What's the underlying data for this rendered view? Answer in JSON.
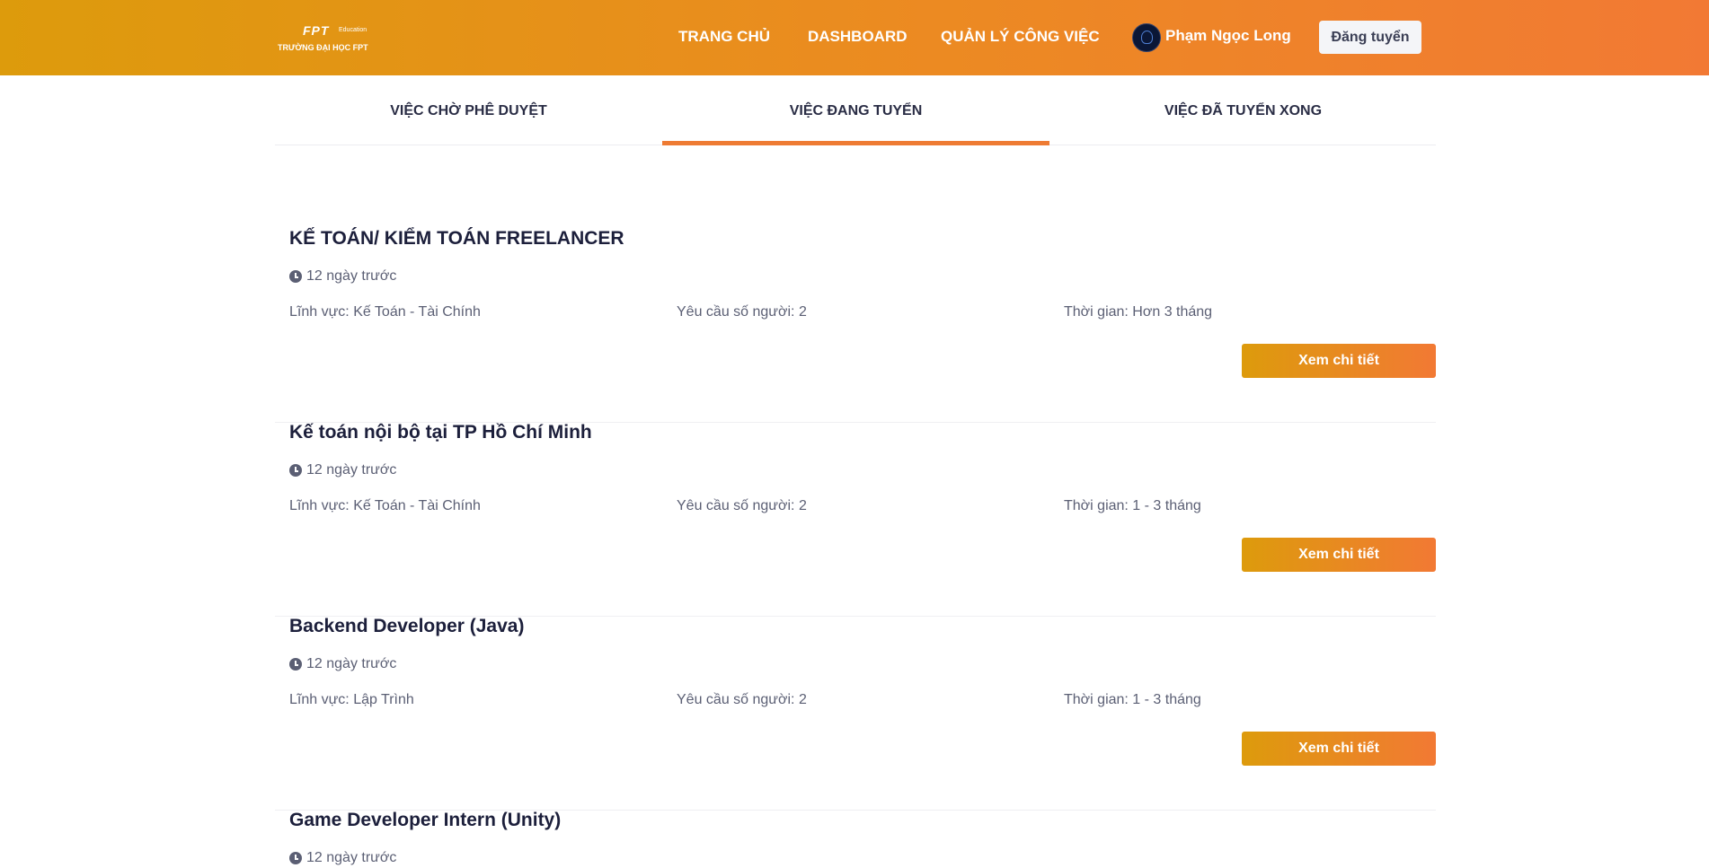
{
  "header": {
    "logo": {
      "mark": "FPT",
      "edu": "Education",
      "school": "TRƯỜNG ĐẠI HỌC FPT"
    },
    "nav": [
      "TRANG CHỦ",
      "DASHBOARD",
      "QUẢN LÝ CÔNG VIỆC"
    ],
    "user_name": "Phạm Ngọc Long",
    "post_button": "Đăng tuyển"
  },
  "tabs": [
    "VIỆC CHỜ PHÊ DUYỆT",
    "VIỆC ĐANG TUYỂN",
    "VIỆC ĐÃ TUYỂN XONG"
  ],
  "active_tab": "VIỆC ĐANG TUYỂN",
  "jobs": [
    {
      "title": "KẾ TOÁN/ KIỂM TOÁN FREELANCER",
      "time": "12 ngày trước",
      "field": "Lĩnh vực: Kế Toán - Tài Chính",
      "people": "Yêu cầu số người: 2",
      "duration": "Thời gian: Hơn 3 tháng",
      "button": "Xem chi tiết"
    },
    {
      "title": "Kế toán nội bộ tại TP Hồ Chí Minh",
      "time": "12 ngày trước",
      "field": "Lĩnh vực: Kế Toán - Tài Chính",
      "people": "Yêu cầu số người: 2",
      "duration": "Thời gian: 1 - 3 tháng",
      "button": "Xem chi tiết"
    },
    {
      "title": "Backend Developer (Java)",
      "time": "12 ngày trước",
      "field": "Lĩnh vực: Lập Trình",
      "people": "Yêu cầu số người: 2",
      "duration": "Thời gian: 1 - 3 tháng",
      "button": "Xem chi tiết"
    },
    {
      "title": "Game Developer Intern (Unity)",
      "time": "12 ngày trước"
    }
  ],
  "colors": {
    "accent": "#ee7b33",
    "gradient_start": "#dd9b0c",
    "gradient_end": "#f27934"
  }
}
